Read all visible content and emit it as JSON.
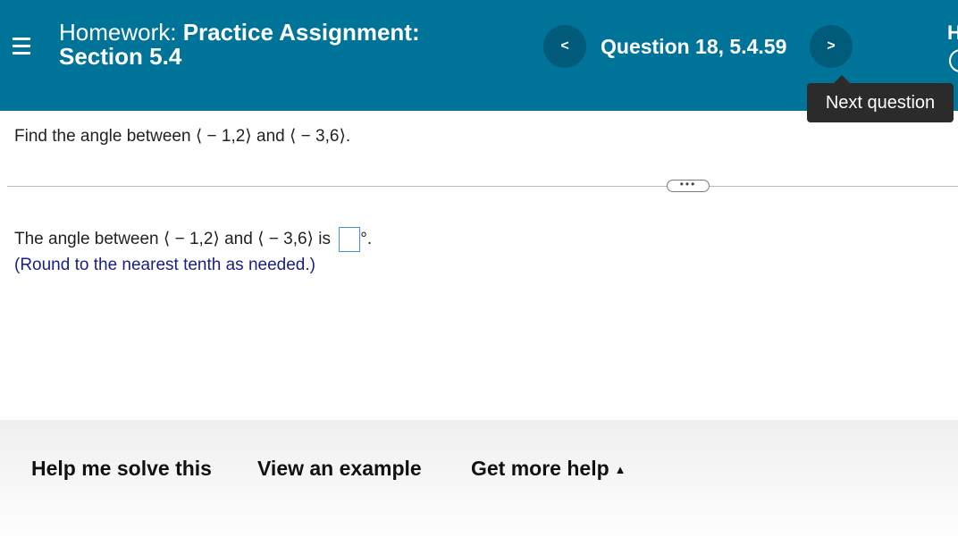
{
  "header": {
    "title_prefix": "Homework:",
    "title_bold": "Practice Assignment:",
    "title_line2": "Section 5.4",
    "question_label": "Question 18, 5.4.59",
    "prev_glyph": "<",
    "next_glyph": ">",
    "right_edge_letter": "H",
    "background_color": "#007399"
  },
  "tooltip": {
    "text": "Next question"
  },
  "problem": {
    "prefix": "Find the angle between ",
    "vector1": "⟨ − 1,2⟩",
    "joiner": " and ",
    "vector2": "⟨ − 3,6⟩",
    "suffix": "."
  },
  "more_pill": {
    "label": "•••"
  },
  "answer": {
    "prefix": "The angle between ",
    "vector1": "⟨ − 1,2⟩",
    "joiner": " and ",
    "vector2": "⟨ − 3,6⟩",
    "is_text": " is ",
    "value": "",
    "degree_symbol": "°",
    "period": "."
  },
  "hint": "(Round to the nearest tenth as needed.)",
  "footer": {
    "help_solve": "Help me solve this",
    "view_example": "View an example",
    "get_more_help": "Get more help",
    "caret": "▲"
  },
  "icons": {
    "menu": "hamburger-menu-icon",
    "prev": "chevron-left-icon",
    "next": "chevron-right-icon",
    "caret": "caret-up-icon"
  }
}
